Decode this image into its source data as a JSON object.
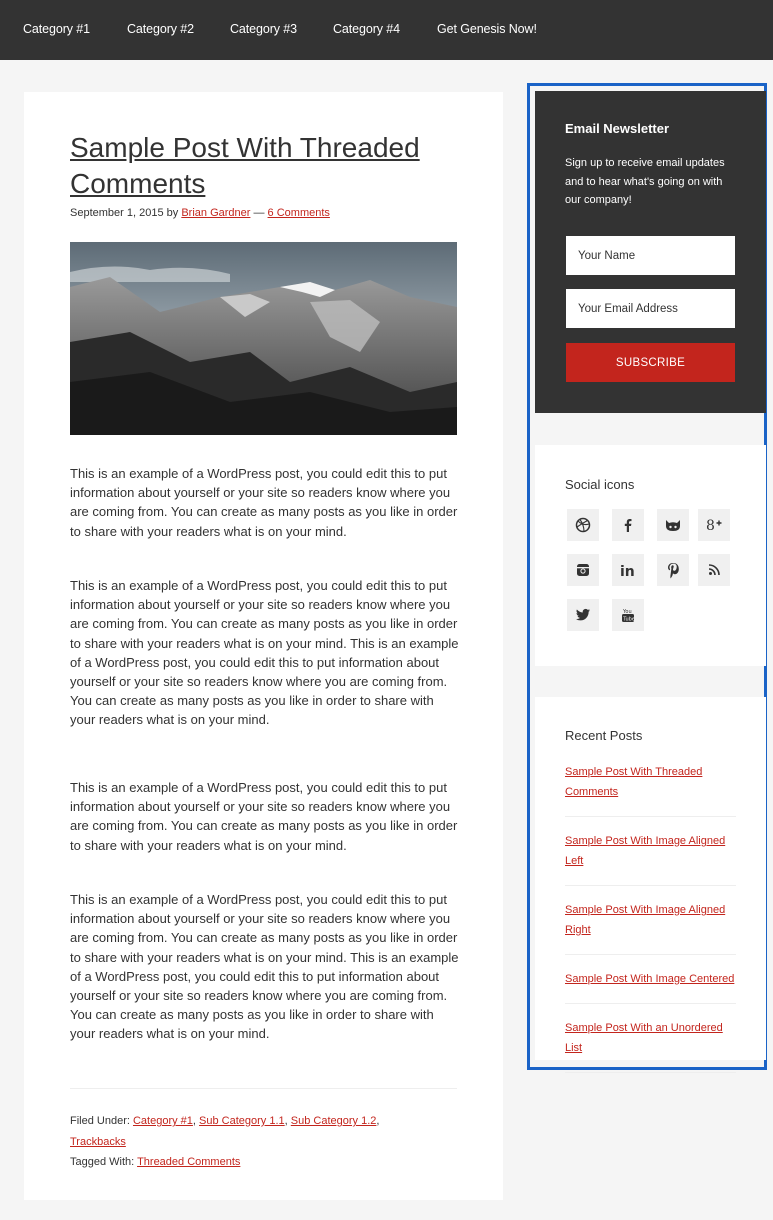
{
  "nav": {
    "items": [
      "Category #1",
      "Category #2",
      "Category #3",
      "Category #4",
      "Get Genesis Now!"
    ]
  },
  "post": {
    "title": "Sample Post With Threaded Comments",
    "date": "September 1, 2015",
    "by": "by",
    "author": "Brian Gardner",
    "sep": "—",
    "comments": "6 Comments",
    "paragraphs": [
      "This is an example of a WordPress post, you could edit this to put information about yourself or your site so readers know where you are coming from. You can create as many posts as you like in order to share with your readers what is on your mind.",
      "This is an example of a WordPress post, you could edit this to put information about yourself or your site so readers know where you are coming from. You can create as many posts as you like in order to share with your readers what is on your mind. This is an example of a WordPress post, you could edit this to put information about yourself or your site so readers know where you are coming from. You can create as many posts as you like in order to share with your readers what is on your mind.",
      "This is an example of a WordPress post, you could edit this to put information about yourself or your site so readers know where you are coming from. You can create as many posts as you like in order to share with your readers what is on your mind.",
      "This is an example of a WordPress post, you could edit this to put information about yourself or your site so readers know where you are coming from. You can create as many posts as you like in order to share with your readers what is on your mind. This is an example of a WordPress post, you could edit this to put information about yourself or your site so readers know where you are coming from. You can create as many posts as you like in order to share with your readers what is on your mind."
    ],
    "filed_label": "Filed Under:",
    "categories": [
      "Category #1",
      "Sub Category 1.1",
      "Sub Category 1.2",
      "Trackbacks"
    ],
    "tagged_label": "Tagged With:",
    "tag": "Threaded Comments"
  },
  "newsletter": {
    "title": "Email Newsletter",
    "text": "Sign up to receive email updates and to hear what's going on with our company!",
    "name_placeholder": "Your Name",
    "email_placeholder": "Your Email Address",
    "button": "SUBSCRIBE"
  },
  "social": {
    "title": "Social icons",
    "icons": [
      "dribbble-icon",
      "facebook-icon",
      "github-icon",
      "google-plus-icon",
      "instagram-icon",
      "linkedin-icon",
      "pinterest-icon",
      "rss-icon",
      "twitter-icon",
      "youtube-icon"
    ]
  },
  "recent": {
    "title": "Recent Posts",
    "posts": [
      "Sample Post With Threaded Comments",
      "Sample Post With Image Aligned Left",
      "Sample Post With Image Aligned Right",
      "Sample Post With Image Centered",
      "Sample Post With an Unordered List"
    ]
  },
  "colors": {
    "accent": "#c3251d",
    "dark": "#333333",
    "highlight": "#1a63c7"
  }
}
